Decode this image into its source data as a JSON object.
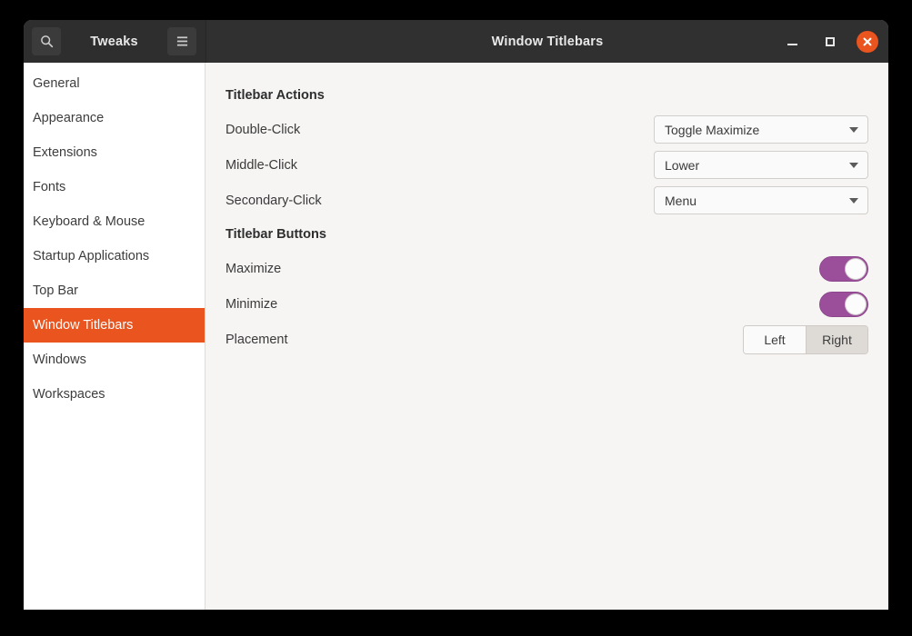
{
  "window": {
    "app_title": "Tweaks",
    "page_title": "Window Titlebars",
    "search_icon": "search-icon",
    "menu_icon": "hamburger-menu-icon",
    "minimize_icon": "minimize-icon",
    "maximize_icon": "maximize-icon",
    "close_icon": "close-icon",
    "accent_color": "#E95420",
    "switch_on_color": "#9B4F9B",
    "headerbar_color": "#303030"
  },
  "sidebar": {
    "items": [
      {
        "label": "General",
        "selected": false
      },
      {
        "label": "Appearance",
        "selected": false
      },
      {
        "label": "Extensions",
        "selected": false
      },
      {
        "label": "Fonts",
        "selected": false
      },
      {
        "label": "Keyboard & Mouse",
        "selected": false
      },
      {
        "label": "Startup Applications",
        "selected": false
      },
      {
        "label": "Top Bar",
        "selected": false
      },
      {
        "label": "Window Titlebars",
        "selected": true
      },
      {
        "label": "Windows",
        "selected": false
      },
      {
        "label": "Workspaces",
        "selected": false
      }
    ]
  },
  "sections": [
    {
      "title": "Titlebar Actions",
      "rows": [
        {
          "label": "Double-Click",
          "type": "combo",
          "value": "Toggle Maximize"
        },
        {
          "label": "Middle-Click",
          "type": "combo",
          "value": "Lower"
        },
        {
          "label": "Secondary-Click",
          "type": "combo",
          "value": "Menu"
        }
      ]
    },
    {
      "title": "Titlebar Buttons",
      "rows": [
        {
          "label": "Maximize",
          "type": "switch",
          "value": "on"
        },
        {
          "label": "Minimize",
          "type": "switch",
          "value": "on"
        },
        {
          "label": "Placement",
          "type": "segmented",
          "options": [
            "Left",
            "Right"
          ],
          "value": "Right"
        }
      ]
    }
  ]
}
